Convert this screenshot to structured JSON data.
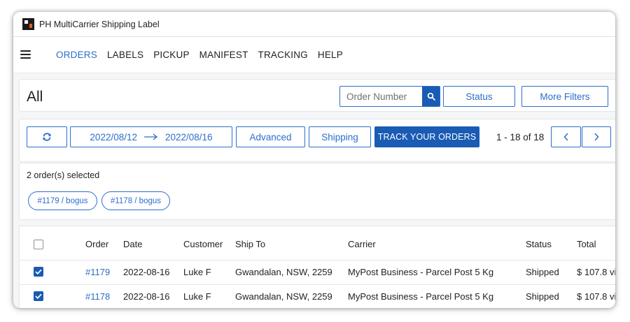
{
  "window": {
    "title": "PH MultiCarrier Shipping Label"
  },
  "nav": {
    "items": [
      {
        "label": "ORDERS",
        "active": true
      },
      {
        "label": "LABELS",
        "active": false
      },
      {
        "label": "PICKUP",
        "active": false
      },
      {
        "label": "MANIFEST",
        "active": false
      },
      {
        "label": "TRACKING",
        "active": false
      },
      {
        "label": "HELP",
        "active": false
      }
    ]
  },
  "filters": {
    "page_title": "All",
    "search_placeholder": "Order Number",
    "status_label": "Status",
    "more_filters_label": "More Filters"
  },
  "toolbar": {
    "date_from": "2022/08/12",
    "date_to": "2022/08/16",
    "advanced_label": "Advanced",
    "shipping_label": "Shipping",
    "track_label": "TRACK YOUR ORDERS",
    "pagination_text": "1 - 18 of 18"
  },
  "selection": {
    "summary": "2 order(s) selected",
    "chips": [
      "#1179 / bogus",
      "#1178 / bogus"
    ]
  },
  "table": {
    "headers": [
      "Order",
      "Date",
      "Customer",
      "Ship To",
      "Carrier",
      "Status",
      "Total"
    ],
    "rows": [
      {
        "checked": true,
        "order": "#1179",
        "date": "2022-08-16",
        "customer": "Luke F",
        "ship_to": "Gwandalan, NSW, 2259",
        "carrier": "MyPost Business - Parcel Post 5 Kg",
        "status": "Shipped",
        "total": "$ 107.8 vi"
      },
      {
        "checked": true,
        "order": "#1178",
        "date": "2022-08-16",
        "customer": "Luke F",
        "ship_to": "Gwandalan, NSW, 2259",
        "carrier": "MyPost Business - Parcel Post 5 Kg",
        "status": "Shipped",
        "total": "$ 107.8 vi"
      }
    ]
  },
  "colors": {
    "accent": "#2c6ecb",
    "primary_button": "#1a5bb4",
    "background": "#f4f6f8"
  }
}
